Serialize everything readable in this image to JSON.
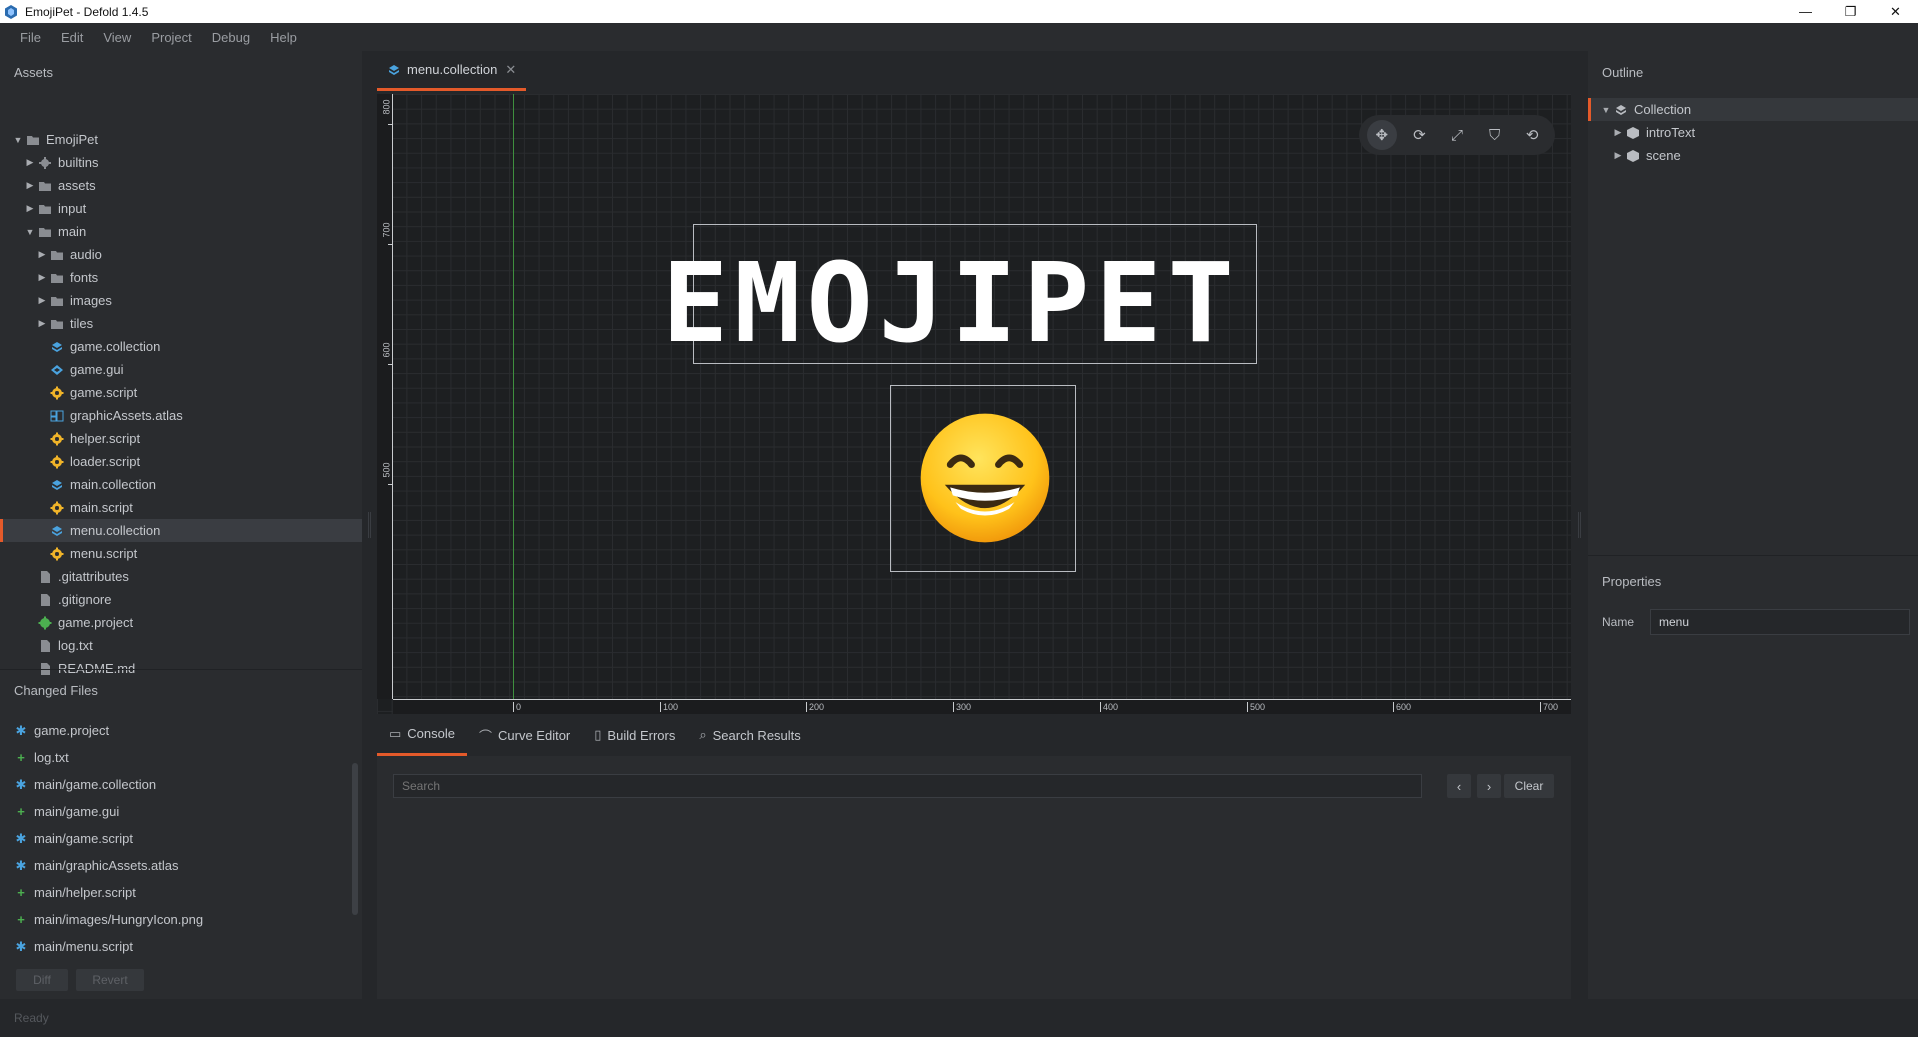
{
  "window": {
    "title": "EmojiPet - Defold 1.4.5",
    "minimize": "—",
    "maximize": "❐",
    "close": "✕"
  },
  "menubar": [
    "File",
    "Edit",
    "View",
    "Project",
    "Debug",
    "Help"
  ],
  "assets": {
    "heading": "Assets",
    "tree": [
      {
        "label": "EmojiPet",
        "icon": "folder-icon",
        "arrow": "▼"
      },
      {
        "label": "builtins",
        "icon": "builtins-icon",
        "arrow": "▶"
      },
      {
        "label": "assets",
        "icon": "folder-icon",
        "arrow": "▶"
      },
      {
        "label": "input",
        "icon": "folder-icon",
        "arrow": "▶"
      },
      {
        "label": "main",
        "icon": "folder-icon",
        "arrow": "▼"
      },
      {
        "label": "audio",
        "icon": "folder-icon",
        "arrow": "▶"
      },
      {
        "label": "fonts",
        "icon": "folder-icon",
        "arrow": "▶"
      },
      {
        "label": "images",
        "icon": "folder-icon",
        "arrow": "▶"
      },
      {
        "label": "tiles",
        "icon": "folder-icon",
        "arrow": "▶"
      },
      {
        "label": "game.collection",
        "icon": "collection-icon",
        "arrow": ""
      },
      {
        "label": "game.gui",
        "icon": "gui-icon",
        "arrow": ""
      },
      {
        "label": "game.script",
        "icon": "script-gear-icon",
        "arrow": ""
      },
      {
        "label": "graphicAssets.atlas",
        "icon": "atlas-icon",
        "arrow": ""
      },
      {
        "label": "helper.script",
        "icon": "script-gear-icon",
        "arrow": ""
      },
      {
        "label": "loader.script",
        "icon": "script-gear-icon",
        "arrow": ""
      },
      {
        "label": "main.collection",
        "icon": "collection-icon",
        "arrow": ""
      },
      {
        "label": "main.script",
        "icon": "script-gear-icon",
        "arrow": ""
      },
      {
        "label": "menu.collection",
        "icon": "collection-icon",
        "arrow": "",
        "selected": true
      },
      {
        "label": "menu.script",
        "icon": "script-gear-icon",
        "arrow": ""
      },
      {
        "label": ".gitattributes",
        "icon": "file-icon",
        "arrow": ""
      },
      {
        "label": ".gitignore",
        "icon": "file-icon",
        "arrow": ""
      },
      {
        "label": "game.project",
        "icon": "project-gear-icon",
        "arrow": ""
      },
      {
        "label": "log.txt",
        "icon": "file-icon",
        "arrow": ""
      },
      {
        "label": "README.md",
        "icon": "file-icon",
        "arrow": ""
      }
    ]
  },
  "changed_files": {
    "heading": "Changed Files",
    "items": [
      {
        "label": "game.project",
        "status": "modified"
      },
      {
        "label": "log.txt",
        "status": "added"
      },
      {
        "label": "main/game.collection",
        "status": "modified"
      },
      {
        "label": "main/game.gui",
        "status": "added"
      },
      {
        "label": "main/game.script",
        "status": "modified"
      },
      {
        "label": "main/graphicAssets.atlas",
        "status": "modified"
      },
      {
        "label": "main/helper.script",
        "status": "added"
      },
      {
        "label": "main/images/HungryIcon.png",
        "status": "added"
      },
      {
        "label": "main/menu.script",
        "status": "modified"
      }
    ],
    "diff_label": "Diff",
    "revert_label": "Revert"
  },
  "status": "Ready",
  "editor": {
    "tab_label": "menu.collection",
    "tab_close": "✕",
    "ruler_v": [
      "800",
      "700",
      "600",
      "500"
    ],
    "ruler_h": [
      "0",
      "100",
      "200",
      "300",
      "400",
      "500",
      "600",
      "700"
    ],
    "logo": "EMOJIPET",
    "tools": [
      "move-tool-icon",
      "rotate-tool-icon",
      "scale-tool-icon",
      "visibility-filter-icon",
      "camera-reset-icon"
    ]
  },
  "bottom": {
    "tabs": [
      {
        "label": "Console",
        "icon": "console-icon"
      },
      {
        "label": "Curve Editor",
        "icon": "curve-icon"
      },
      {
        "label": "Build Errors",
        "icon": "build-errors-icon"
      },
      {
        "label": "Search Results",
        "icon": "search-icon"
      }
    ],
    "search_placeholder": "Search",
    "prev": "‹",
    "next": "›",
    "clear_label": "Clear"
  },
  "outline": {
    "heading": "Outline",
    "items": [
      {
        "label": "Collection",
        "arrow": "▼"
      },
      {
        "label": "introText",
        "arrow": "▶"
      },
      {
        "label": "scene",
        "arrow": "▶"
      }
    ]
  },
  "properties": {
    "heading": "Properties",
    "name_label": "Name",
    "name_value": "menu"
  },
  "colors": {
    "accent": "#e45a2a",
    "modified": "#4aa3df",
    "added": "#4caf50"
  }
}
